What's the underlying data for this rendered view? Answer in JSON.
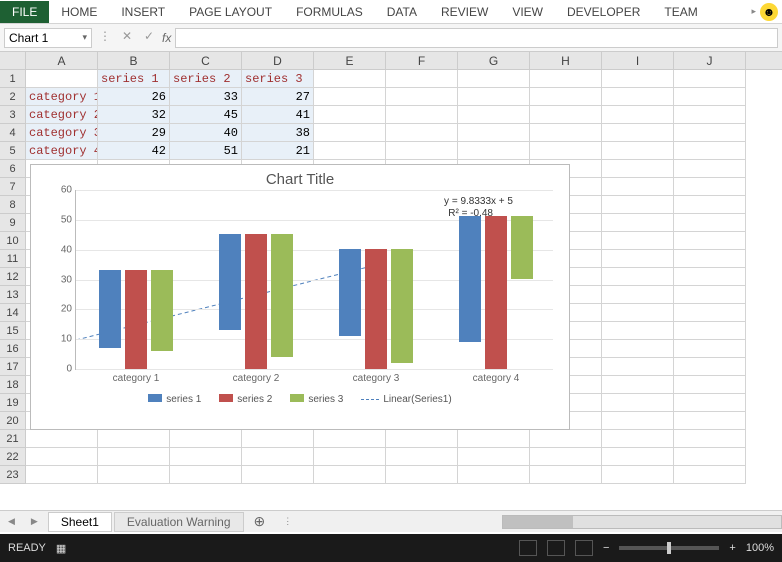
{
  "ribbon": {
    "tabs": [
      "FILE",
      "HOME",
      "INSERT",
      "PAGE LAYOUT",
      "FORMULAS",
      "DATA",
      "REVIEW",
      "VIEW",
      "DEVELOPER",
      "TEAM"
    ]
  },
  "namebox": "Chart 1",
  "fx": "fx",
  "columns": [
    "A",
    "B",
    "C",
    "D",
    "E",
    "F",
    "G",
    "H",
    "I",
    "J"
  ],
  "rows": [
    "1",
    "2",
    "3",
    "4",
    "5",
    "6",
    "7",
    "8",
    "9",
    "10",
    "11",
    "12",
    "13",
    "14",
    "15",
    "16",
    "17",
    "18",
    "19",
    "20",
    "21",
    "22",
    "23"
  ],
  "table": {
    "headers": [
      "series 1",
      "series 2",
      "series 3"
    ],
    "categories": [
      "category 1",
      "category 2",
      "category 3",
      "category 4"
    ],
    "values": [
      [
        26,
        33,
        27
      ],
      [
        32,
        45,
        41
      ],
      [
        29,
        40,
        38
      ],
      [
        42,
        51,
        21
      ]
    ]
  },
  "chart_data": {
    "type": "bar",
    "title": "Chart Title",
    "categories": [
      "category 1",
      "category 2",
      "category 3",
      "category 4"
    ],
    "series": [
      {
        "name": "series 1",
        "values": [
          26,
          32,
          29,
          42
        ],
        "color": "#4f81bd"
      },
      {
        "name": "series 2",
        "values": [
          33,
          45,
          40,
          51
        ],
        "color": "#c0504d"
      },
      {
        "name": "series 3",
        "values": [
          27,
          41,
          38,
          21
        ],
        "color": "#9bbb59"
      }
    ],
    "ylim": [
      0,
      60
    ],
    "yticks": [
      0,
      10,
      20,
      30,
      40,
      50,
      60
    ],
    "trendline": {
      "name": "Linear(Series1)",
      "equation": "y = 9.8333x + 5",
      "r2": "R² = -0.48"
    }
  },
  "sheet_tabs": {
    "active": "Sheet1",
    "inactive": "Evaluation Warning"
  },
  "status": {
    "ready": "READY",
    "zoom": "100%"
  }
}
